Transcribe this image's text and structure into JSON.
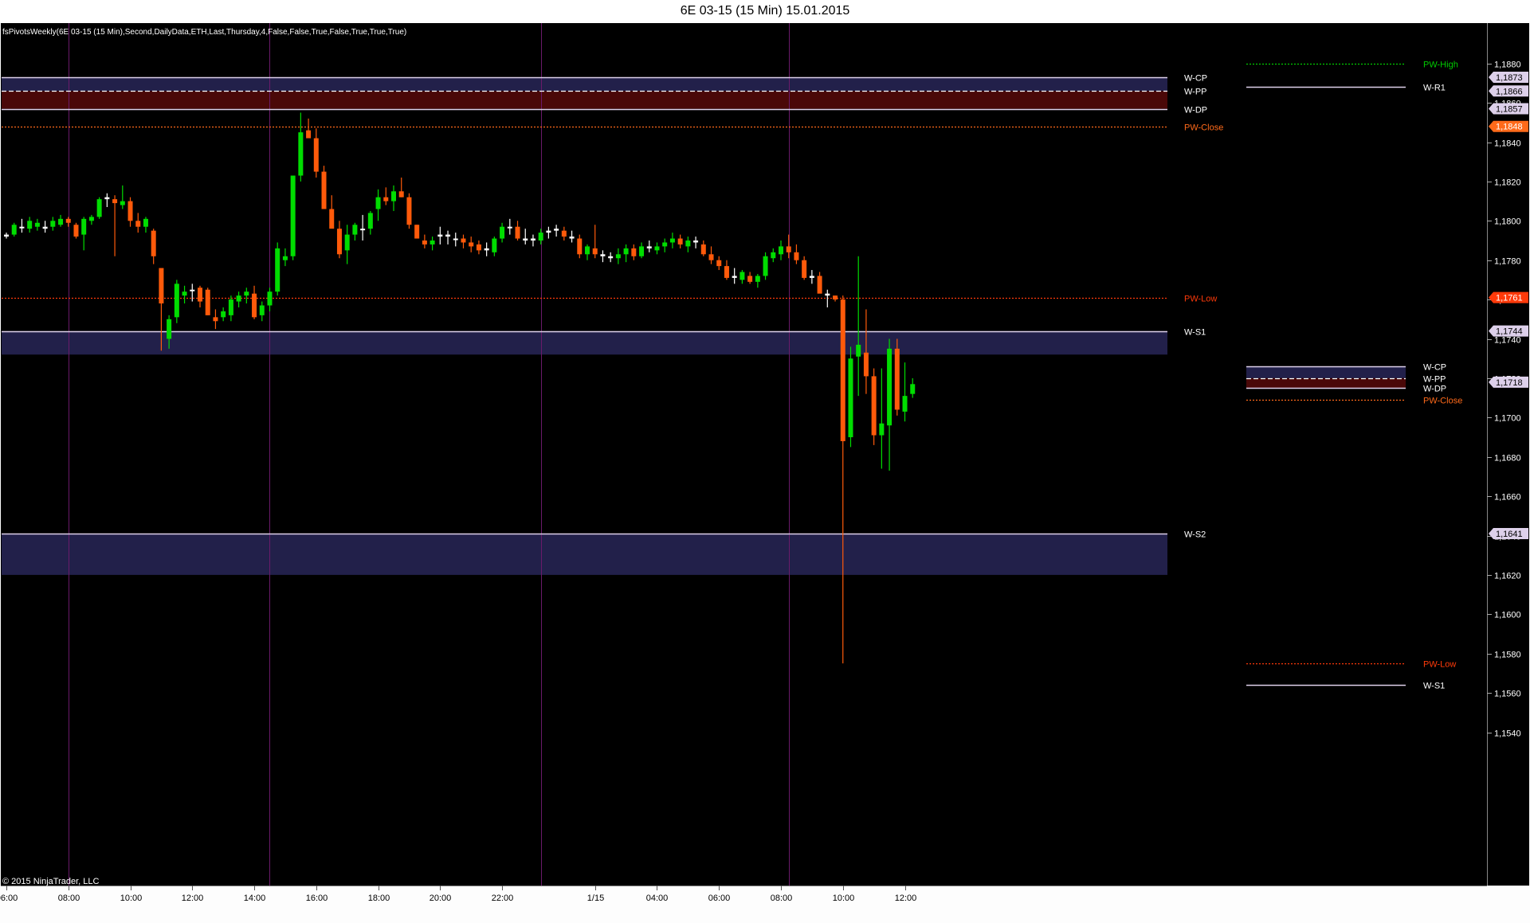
{
  "window": {
    "title": "6E 03-15 (15 Min)  15.01.2015"
  },
  "chart": {
    "indicator_label": "fsPivotsWeekly(6E 03-15 (15 Min),Second,DailyData,ETH,Last,Thursday,4,False,False,True,False,True,True,True)",
    "copyright": "© 2015 NinjaTrader, LLC",
    "colors": {
      "background": "#000000",
      "up_candle": "#00dd00",
      "down_candle": "#ff5a0a",
      "doji": "#ffffff",
      "session_line": "#6a1a6a",
      "pw_high": "#00cc00",
      "pw_close": "#ff6a1a",
      "pw_low": "#ff3a0a",
      "pivot_line": "#ddd0ea",
      "band_blue": "#22204a",
      "band_red": "#4a0808"
    }
  },
  "chart_data": {
    "type": "candlestick",
    "instrument": "6E 03-15",
    "interval": "15 Min",
    "ylim": [
      1.1535,
      1.189
    ],
    "yticks": [
      {
        "v": 1.188,
        "label": "1,1880"
      },
      {
        "v": 1.186,
        "label": "1,1860"
      },
      {
        "v": 1.184,
        "label": "1,1840"
      },
      {
        "v": 1.182,
        "label": "1,1820"
      },
      {
        "v": 1.18,
        "label": "1,1800"
      },
      {
        "v": 1.178,
        "label": "1,1780"
      },
      {
        "v": 1.176,
        "label": "1,1760"
      },
      {
        "v": 1.174,
        "label": "1,1740"
      },
      {
        "v": 1.172,
        "label": "1,1720"
      },
      {
        "v": 1.17,
        "label": "1,1700"
      },
      {
        "v": 1.168,
        "label": "1,1680"
      },
      {
        "v": 1.166,
        "label": "1,1660"
      },
      {
        "v": 1.164,
        "label": "1,1640"
      },
      {
        "v": 1.162,
        "label": "1,1620"
      },
      {
        "v": 1.16,
        "label": "1,1600"
      },
      {
        "v": 1.158,
        "label": "1,1580"
      },
      {
        "v": 1.156,
        "label": "1,1560"
      },
      {
        "v": 1.154,
        "label": "1,1540"
      }
    ],
    "xticks": [
      {
        "bar": 0,
        "label": "06:00"
      },
      {
        "bar": 8,
        "label": "08:00"
      },
      {
        "bar": 16,
        "label": "10:00"
      },
      {
        "bar": 24,
        "label": "12:00"
      },
      {
        "bar": 32,
        "label": "14:00"
      },
      {
        "bar": 40,
        "label": "16:00"
      },
      {
        "bar": 48,
        "label": "18:00"
      },
      {
        "bar": 56,
        "label": "20:00"
      },
      {
        "bar": 64,
        "label": "22:00"
      },
      {
        "bar": 76,
        "label": "1/15"
      },
      {
        "bar": 84,
        "label": "04:00"
      },
      {
        "bar": 92,
        "label": "06:00"
      },
      {
        "bar": 100,
        "label": "08:00"
      },
      {
        "bar": 108,
        "label": "10:00"
      },
      {
        "bar": 116,
        "label": "12:00"
      }
    ],
    "session_breaks": [
      8,
      34,
      69,
      101
    ],
    "price_markers": [
      {
        "value": 1.1873,
        "label": "1,1873",
        "color": "#ddd0ea"
      },
      {
        "value": 1.1866,
        "label": "1,1866",
        "color": "#ddd0ea"
      },
      {
        "value": 1.1857,
        "label": "1,1857",
        "color": "#ddd0ea"
      },
      {
        "value": 1.1848,
        "label": "1,1848",
        "color": "#ff6a1a"
      },
      {
        "value": 1.1761,
        "label": "1,1761",
        "color": "#ff3a0a"
      },
      {
        "value": 1.1744,
        "label": "1,1744",
        "color": "#ddd0ea"
      },
      {
        "value": 1.1718,
        "label": "1,1718",
        "color": "#ddd0ea"
      },
      {
        "value": 1.1641,
        "label": "1,1641",
        "color": "#ddd0ea"
      }
    ],
    "bands": [
      {
        "top": 1.1873,
        "bottom": 1.1866,
        "kind": "blue"
      },
      {
        "top": 1.1866,
        "bottom": 1.1857,
        "kind": "red"
      },
      {
        "top": 1.1744,
        "bottom": 1.1732,
        "kind": "blue"
      },
      {
        "top": 1.1641,
        "bottom": 1.162,
        "kind": "blue"
      }
    ],
    "levels": [
      {
        "name": "W-CP",
        "value": 1.1873,
        "style": "solid",
        "color": "#ddd0ea",
        "label_color": "#ffffff"
      },
      {
        "name": "W-PP",
        "value": 1.1866,
        "style": "dashed",
        "color": "#ffffff",
        "label_color": "#ffffff"
      },
      {
        "name": "W-DP",
        "value": 1.1857,
        "style": "solid",
        "color": "#ddd0ea",
        "label_color": "#ffffff"
      },
      {
        "name": "PW-Close",
        "value": 1.1848,
        "style": "dotted",
        "color": "#ff6a1a",
        "label_color": "#ff6a1a"
      },
      {
        "name": "PW-Low",
        "value": 1.1761,
        "style": "dotted",
        "color": "#ff3a0a",
        "label_color": "#ff3a0a"
      },
      {
        "name": "W-S1",
        "value": 1.1744,
        "style": "solid",
        "color": "#ddd0ea",
        "label_color": "#ffffff"
      },
      {
        "name": "W-S2",
        "value": 1.1641,
        "style": "solid",
        "color": "#ddd0ea",
        "label_color": "#ffffff"
      }
    ],
    "prev_week_levels": [
      {
        "name": "PW-High",
        "value": 1.188,
        "style": "dotted",
        "color": "#00cc00",
        "label_color": "#00cc00"
      },
      {
        "name": "W-R1",
        "value": 1.1868,
        "style": "solid",
        "color": "#ddd0ea",
        "label_color": "#ffffff"
      },
      {
        "name": "W-CP",
        "value": 1.1726,
        "style": "solid",
        "color": "#ddd0ea",
        "label_color": "#ffffff"
      },
      {
        "name": "W-PP",
        "value": 1.172,
        "style": "dashed",
        "color": "#ffffff",
        "label_color": "#ffffff"
      },
      {
        "name": "W-DP",
        "value": 1.1715,
        "style": "solid",
        "color": "#ddd0ea",
        "label_color": "#ffffff"
      },
      {
        "name": "PW-Close",
        "value": 1.1709,
        "style": "dotted",
        "color": "#ff6a1a",
        "label_color": "#ff6a1a"
      },
      {
        "name": "PW-Low",
        "value": 1.1575,
        "style": "dotted",
        "color": "#ff3a0a",
        "label_color": "#ff3a0a"
      },
      {
        "name": "W-S1",
        "value": 1.1564,
        "style": "solid",
        "color": "#ddd0ea",
        "label_color": "#ffffff"
      }
    ],
    "prev_week_bands": [
      {
        "top": 1.1726,
        "bottom": 1.172,
        "kind": "blue"
      },
      {
        "top": 1.172,
        "bottom": 1.1715,
        "kind": "red"
      }
    ],
    "candles": [
      [
        1.1793,
        1.1794,
        1.1791,
        1.1792
      ],
      [
        1.1793,
        1.1799,
        1.1792,
        1.1798
      ],
      [
        1.1797,
        1.1801,
        1.1794,
        1.1797
      ],
      [
        1.1796,
        1.1802,
        1.1794,
        1.18
      ],
      [
        1.1797,
        1.1801,
        1.1795,
        1.1799
      ],
      [
        1.1797,
        1.18,
        1.1794,
        1.1796
      ],
      [
        1.1797,
        1.1802,
        1.1795,
        1.18
      ],
      [
        1.1798,
        1.1803,
        1.1797,
        1.1801
      ],
      [
        1.1801,
        1.1802,
        1.1797,
        1.1799
      ],
      [
        1.1798,
        1.1799,
        1.1791,
        1.1792
      ],
      [
        1.1793,
        1.1802,
        1.1785,
        1.1801
      ],
      [
        1.18,
        1.1803,
        1.1798,
        1.1802
      ],
      [
        1.1802,
        1.1812,
        1.1801,
        1.1811
      ],
      [
        1.1811,
        1.1814,
        1.1807,
        1.1812
      ],
      [
        1.1811,
        1.1813,
        1.1782,
        1.1809
      ],
      [
        1.1808,
        1.1818,
        1.1806,
        1.181
      ],
      [
        1.181,
        1.1812,
        1.1797,
        1.18
      ],
      [
        1.18,
        1.1804,
        1.1794,
        1.1797
      ],
      [
        1.1797,
        1.1802,
        1.1794,
        1.1801
      ],
      [
        1.1795,
        1.1796,
        1.1778,
        1.1782
      ],
      [
        1.1776,
        1.1772,
        1.1734,
        1.1758
      ],
      [
        1.174,
        1.1752,
        1.1735,
        1.175
      ],
      [
        1.1751,
        1.177,
        1.1748,
        1.1768
      ],
      [
        1.1762,
        1.1767,
        1.1758,
        1.1764
      ],
      [
        1.1765,
        1.1768,
        1.1759,
        1.1765
      ],
      [
        1.1766,
        1.1767,
        1.1756,
        1.1759
      ],
      [
        1.1765,
        1.1766,
        1.1752,
        1.1752
      ],
      [
        1.1751,
        1.1755,
        1.1745,
        1.1749
      ],
      [
        1.1751,
        1.1756,
        1.1749,
        1.1754
      ],
      [
        1.1752,
        1.1762,
        1.1749,
        1.176
      ],
      [
        1.1759,
        1.1764,
        1.1756,
        1.1762
      ],
      [
        1.1762,
        1.1766,
        1.1758,
        1.1764
      ],
      [
        1.1763,
        1.1767,
        1.175,
        1.1751
      ],
      [
        1.1752,
        1.1759,
        1.1749,
        1.1757
      ],
      [
        1.1757,
        1.1766,
        1.1754,
        1.1764
      ],
      [
        1.1764,
        1.1789,
        1.1762,
        1.1786
      ],
      [
        1.178,
        1.1786,
        1.1777,
        1.1782
      ],
      [
        1.1782,
        1.1822,
        1.178,
        1.1823
      ],
      [
        1.1823,
        1.1855,
        1.182,
        1.1845
      ],
      [
        1.1846,
        1.1852,
        1.1843,
        1.1842
      ],
      [
        1.1842,
        1.1847,
        1.1822,
        1.1825
      ],
      [
        1.1825,
        1.1828,
        1.1806,
        1.1806
      ],
      [
        1.1806,
        1.1813,
        1.1797,
        1.1796
      ],
      [
        1.1796,
        1.18,
        1.1781,
        1.1783
      ],
      [
        1.1785,
        1.1798,
        1.1778,
        1.1793
      ],
      [
        1.1793,
        1.1799,
        1.179,
        1.1798
      ],
      [
        1.1796,
        1.1803,
        1.179,
        1.1796
      ],
      [
        1.1796,
        1.1805,
        1.1793,
        1.1804
      ],
      [
        1.1806,
        1.1816,
        1.18,
        1.1812
      ],
      [
        1.1812,
        1.1817,
        1.1808,
        1.181
      ],
      [
        1.181,
        1.1818,
        1.1805,
        1.1815
      ],
      [
        1.1815,
        1.1822,
        1.1812,
        1.1812
      ],
      [
        1.1812,
        1.1814,
        1.1796,
        1.1798
      ],
      [
        1.1798,
        1.1798,
        1.1791,
        1.1791
      ],
      [
        1.179,
        1.1793,
        1.1786,
        1.1788
      ],
      [
        1.1788,
        1.1792,
        1.1785,
        1.179
      ],
      [
        1.1793,
        1.1797,
        1.1788,
        1.1792
      ],
      [
        1.1792,
        1.1795,
        1.1788,
        1.1793
      ],
      [
        1.1791,
        1.1794,
        1.1787,
        1.1791
      ],
      [
        1.1791,
        1.1793,
        1.1786,
        1.1789
      ],
      [
        1.1789,
        1.1792,
        1.1784,
        1.1787
      ],
      [
        1.1788,
        1.179,
        1.1783,
        1.1785
      ],
      [
        1.1785,
        1.1789,
        1.1782,
        1.1786
      ],
      [
        1.1784,
        1.1792,
        1.1782,
        1.1791
      ],
      [
        1.1791,
        1.1799,
        1.1789,
        1.1797
      ],
      [
        1.1797,
        1.1801,
        1.1793,
        1.1797
      ],
      [
        1.1797,
        1.18,
        1.179,
        1.1791
      ],
      [
        1.1791,
        1.1796,
        1.1788,
        1.179
      ],
      [
        1.179,
        1.1793,
        1.1787,
        1.1791
      ],
      [
        1.179,
        1.1796,
        1.1788,
        1.1794
      ],
      [
        1.1794,
        1.1797,
        1.1791,
        1.1795
      ],
      [
        1.1795,
        1.1798,
        1.1792,
        1.1796
      ],
      [
        1.1795,
        1.1797,
        1.179,
        1.1792
      ],
      [
        1.1792,
        1.1795,
        1.1789,
        1.1791
      ],
      [
        1.1791,
        1.1793,
        1.1781,
        1.1783
      ],
      [
        1.1783,
        1.1788,
        1.178,
        1.1787
      ],
      [
        1.1786,
        1.1798,
        1.1781,
        1.1783
      ],
      [
        1.1783,
        1.1785,
        1.1779,
        1.1782
      ],
      [
        1.1781,
        1.1784,
        1.1779,
        1.1782
      ],
      [
        1.1781,
        1.1786,
        1.1778,
        1.1783
      ],
      [
        1.1783,
        1.1788,
        1.1779,
        1.1786
      ],
      [
        1.1786,
        1.1788,
        1.178,
        1.1782
      ],
      [
        1.1782,
        1.1789,
        1.1781,
        1.1787
      ],
      [
        1.1786,
        1.179,
        1.1784,
        1.1787
      ],
      [
        1.1785,
        1.1789,
        1.1783,
        1.1787
      ],
      [
        1.1787,
        1.1791,
        1.1784,
        1.1789
      ],
      [
        1.1789,
        1.1794,
        1.1786,
        1.1791
      ],
      [
        1.1791,
        1.1793,
        1.1786,
        1.1788
      ],
      [
        1.1787,
        1.1792,
        1.1784,
        1.179
      ],
      [
        1.179,
        1.1792,
        1.1786,
        1.1789
      ],
      [
        1.1788,
        1.179,
        1.1782,
        1.1783
      ],
      [
        1.1783,
        1.1787,
        1.1778,
        1.178
      ],
      [
        1.178,
        1.1782,
        1.1775,
        1.1777
      ],
      [
        1.1777,
        1.178,
        1.177,
        1.1771
      ],
      [
        1.1772,
        1.1776,
        1.1768,
        1.1771
      ],
      [
        1.177,
        1.1775,
        1.1768,
        1.1774
      ],
      [
        1.1772,
        1.1774,
        1.1768,
        1.1769
      ],
      [
        1.1769,
        1.1773,
        1.1766,
        1.1772
      ],
      [
        1.1772,
        1.1784,
        1.177,
        1.1782
      ],
      [
        1.1781,
        1.1786,
        1.1779,
        1.1784
      ],
      [
        1.1783,
        1.179,
        1.178,
        1.1787
      ],
      [
        1.1787,
        1.1793,
        1.1781,
        1.1784
      ],
      [
        1.1784,
        1.1788,
        1.1778,
        1.178
      ],
      [
        1.178,
        1.1782,
        1.177,
        1.1771
      ],
      [
        1.1771,
        1.1775,
        1.1768,
        1.1772
      ],
      [
        1.1772,
        1.1774,
        1.1764,
        1.1763
      ],
      [
        1.1763,
        1.1765,
        1.1756,
        1.1762
      ],
      [
        1.1762,
        1.1762,
        1.1759,
        1.176
      ],
      [
        1.176,
        1.1762,
        1.1575,
        1.1688
      ],
      [
        1.169,
        1.1736,
        1.1685,
        1.173
      ],
      [
        1.1731,
        1.1782,
        1.1711,
        1.1737
      ],
      [
        1.1733,
        1.1755,
        1.1712,
        1.1721
      ],
      [
        1.1721,
        1.1725,
        1.1686,
        1.1691
      ],
      [
        1.1691,
        1.1725,
        1.1674,
        1.1697
      ],
      [
        1.1696,
        1.174,
        1.1673,
        1.1735
      ],
      [
        1.1735,
        1.174,
        1.1701,
        1.1704
      ],
      [
        1.1703,
        1.1728,
        1.1698,
        1.1711
      ],
      [
        1.1712,
        1.172,
        1.171,
        1.1717
      ]
    ]
  }
}
